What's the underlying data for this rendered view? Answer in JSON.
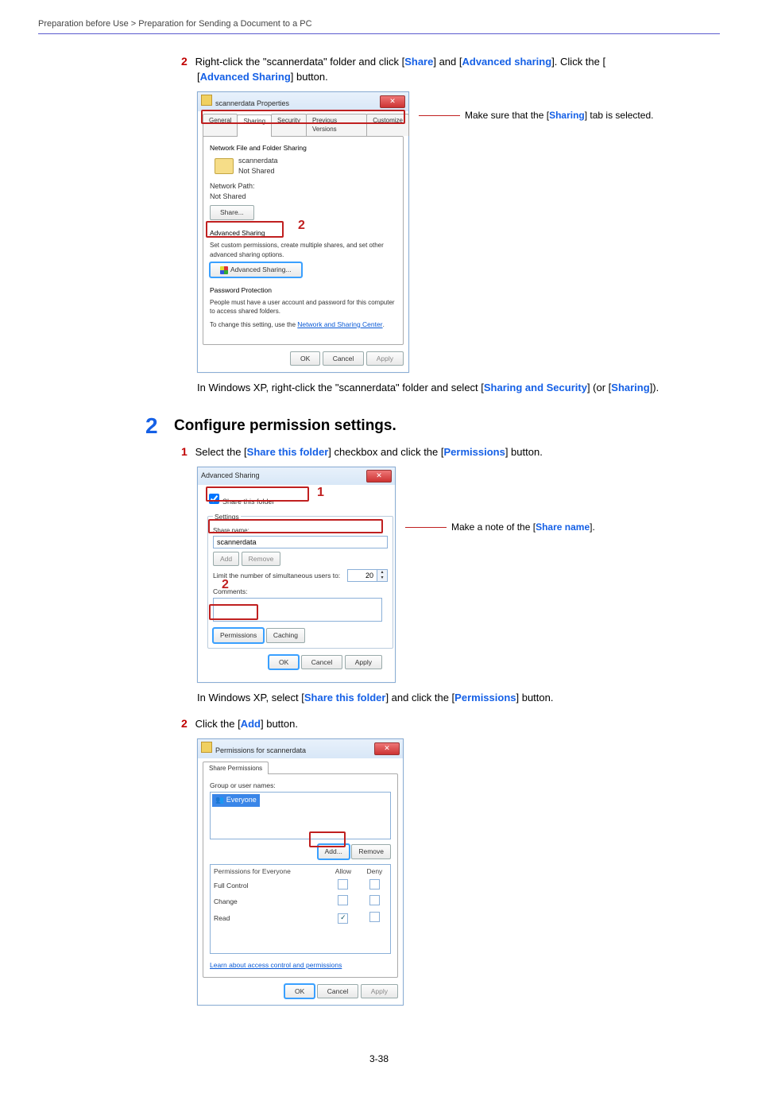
{
  "breadcrumb": "Preparation before Use > Preparation for Sending a Document to a PC",
  "page_number": "3-38",
  "step_a": {
    "num": "2",
    "text_prefix": "Right-click the \"scannerdata\" folder and click [",
    "share": "Share",
    "text_mid1": "] and [",
    "adv": "Advanced sharing",
    "text_mid2": "]. Click the [",
    "adv_btn": "Advanced Sharing",
    "text_end": "] button."
  },
  "dlg1": {
    "title": "scannerdata Properties",
    "tabs": {
      "general": "General",
      "sharing": "Sharing",
      "security": "Security",
      "prev": "Previous Versions",
      "cust": "Customize"
    },
    "group1_title": "Network File and Folder Sharing",
    "folder_name": "scannerdata",
    "folder_status": "Not Shared",
    "netpath_label": "Network Path:",
    "netpath_value": "Not Shared",
    "share_btn": "Share...",
    "group2_title": "Advanced Sharing",
    "group2_text": "Set custom permissions, create multiple shares, and set other advanced sharing options.",
    "adv_btn": "Advanced Sharing...",
    "group3_title": "Password Protection",
    "group3_text": "People must have a user account and password for this computer to access shared folders.",
    "group3_link_pre": "To change this setting, use the ",
    "group3_link": "Network and Sharing Center",
    "ok": "OK",
    "cancel": "Cancel",
    "apply": "Apply",
    "callout2": "2"
  },
  "annot1_pre": "Make sure that the [",
  "annot1_link": "Sharing",
  "annot1_post": "] tab is selected.",
  "xp_note1_pre": "In Windows XP, right-click the \"scannerdata\" folder and select [",
  "xp_note1_link1": "Sharing and Security",
  "xp_note1_mid": "] (or [",
  "xp_note1_link2": "Sharing",
  "xp_note1_post": "]).",
  "step2": {
    "bignum": "2",
    "title": "Configure permission settings."
  },
  "step_b": {
    "num": "1",
    "pre": "Select the [",
    "link1": "Share this folder",
    "mid": "] checkbox and click the [",
    "link2": "Permissions",
    "post": "] button."
  },
  "dlg2": {
    "title": "Advanced Sharing",
    "chk_label": "Share this folder",
    "settings": "Settings",
    "share_name_label": "Share name:",
    "share_name_value": "scannerdata",
    "add": "Add",
    "remove": "Remove",
    "limit_label": "Limit the number of simultaneous users to:",
    "limit_value": "20",
    "comments": "Comments:",
    "perm": "Permissions",
    "cache": "Caching",
    "ok": "OK",
    "cancel": "Cancel",
    "apply": "Apply",
    "callout1": "1",
    "callout2": "2"
  },
  "annot2_pre": "Make a note of the [",
  "annot2_link": "Share name",
  "annot2_post": "].",
  "xp_note2_pre": "In Windows XP, select [",
  "xp_note2_link1": "Share this folder",
  "xp_note2_mid": "] and click the [",
  "xp_note2_link2": "Permissions",
  "xp_note2_post": "] button.",
  "step_c": {
    "num": "2",
    "pre": "Click the [",
    "link": "Add",
    "post": "] button."
  },
  "dlg3": {
    "title": "Permissions for scannerdata",
    "tab": "Share Permissions",
    "grp_label": "Group or user names:",
    "everyone": "Everyone",
    "add": "Add...",
    "remove": "Remove",
    "perm_for": "Permissions for Everyone",
    "allow": "Allow",
    "deny": "Deny",
    "full": "Full Control",
    "change": "Change",
    "read": "Read",
    "learn": "Learn about access control and permissions",
    "ok": "OK",
    "cancel": "Cancel",
    "apply": "Apply"
  }
}
